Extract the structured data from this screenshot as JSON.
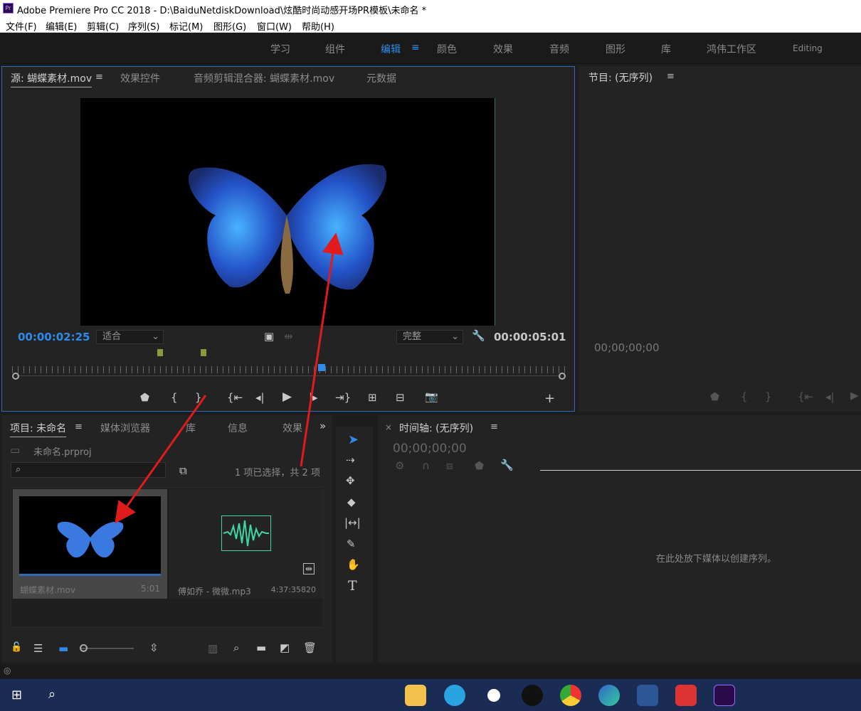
{
  "window": {
    "title": "Adobe Premiere Pro CC 2018 - D:\\BaiduNetdiskDownload\\炫酷时尚动感开场PR模板\\未命名 *",
    "app_icon": "Pr"
  },
  "menu": [
    "文件(F)",
    "编辑(E)",
    "剪辑(C)",
    "序列(S)",
    "标记(M)",
    "图形(G)",
    "窗口(W)",
    "帮助(H)"
  ],
  "workspaces": [
    "学习",
    "组件",
    "编辑",
    "颜色",
    "效果",
    "音频",
    "图形",
    "库",
    "鸿伟工作区",
    "Editing"
  ],
  "active_workspace": "编辑",
  "source_panel": {
    "tabs": [
      "源: 蝴蝶素材.mov",
      "效果控件",
      "音频剪辑混合器: 蝴蝶素材.mov",
      "元数据"
    ],
    "timecode_current": "00:00:02:25",
    "timecode_duration": "00:00:05:01",
    "zoom_select": "适合",
    "quality_select": "完整",
    "playhead_fraction": 0.56
  },
  "program_panel": {
    "tab": "节目: (无序列)",
    "timecode": "00;00;00;00"
  },
  "project_panel": {
    "tabs": [
      "项目: 未命名",
      "媒体浏览器",
      "库",
      "信息",
      "效果"
    ],
    "project_file": "未命名.prproj",
    "search_placeholder": "",
    "selection_status": "1 项已选择，共 2 项",
    "items": [
      {
        "name": "蝴蝶素材.mov",
        "duration": "5:01"
      },
      {
        "name": "傅如乔 - 微微.mp3",
        "duration": "4:37:35820"
      }
    ]
  },
  "timeline_panel": {
    "tab": "时间轴: (无序列)",
    "timecode": "00;00;00;00",
    "empty_message": "在此处放下媒体以创建序列。"
  },
  "colors": {
    "accent": "#2d8ceb",
    "arrow": "#e11b1b",
    "audio_green": "#3fd6a0"
  }
}
